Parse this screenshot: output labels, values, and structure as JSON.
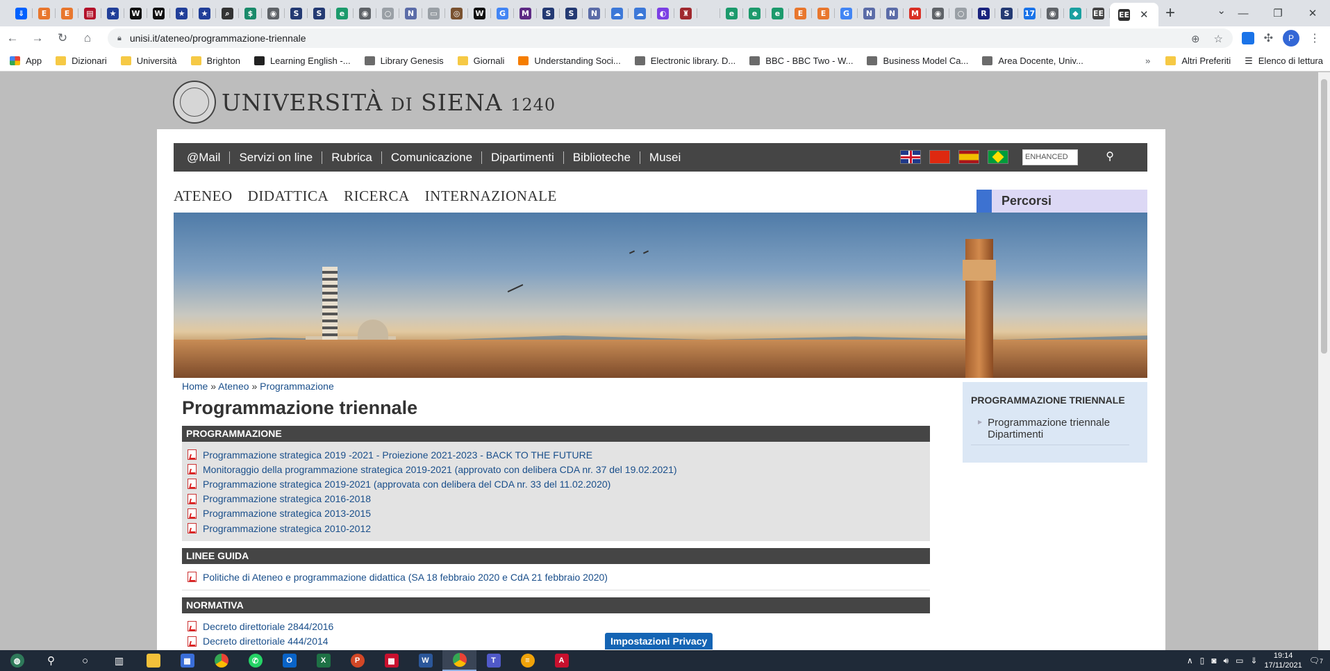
{
  "browser": {
    "tabs": [
      {
        "icon": "dropbox-icon",
        "glyph": "⇓",
        "color": "#0061fe"
      },
      {
        "icon": "e-icon",
        "glyph": "E",
        "color": "#e8772e"
      },
      {
        "icon": "e-icon",
        "glyph": "E",
        "color": "#e8772e"
      },
      {
        "icon": "book-icon",
        "glyph": "▤",
        "color": "#b3122a"
      },
      {
        "icon": "eu-icon",
        "glyph": "★",
        "color": "#213f99"
      },
      {
        "icon": "wikipedia-icon",
        "glyph": "W",
        "color": "#111111"
      },
      {
        "icon": "wikipedia-icon",
        "glyph": "W",
        "color": "#111111"
      },
      {
        "icon": "eu-icon",
        "glyph": "★",
        "color": "#213f99"
      },
      {
        "icon": "eu-icon",
        "glyph": "★",
        "color": "#213f99"
      },
      {
        "icon": "search-icon",
        "glyph": "⌕",
        "color": "#333333"
      },
      {
        "icon": "s-icon",
        "glyph": "$",
        "color": "#1a8a6a"
      },
      {
        "icon": "globe-icon",
        "glyph": "◉",
        "color": "#5f6368"
      },
      {
        "icon": "s-icon",
        "glyph": "S",
        "color": "#243a73"
      },
      {
        "icon": "s-icon",
        "glyph": "S",
        "color": "#243a73"
      },
      {
        "icon": "edge-icon",
        "glyph": "e",
        "color": "#1c9a6c"
      },
      {
        "icon": "globe-icon",
        "glyph": "◉",
        "color": "#5f6368"
      },
      {
        "icon": "loading-icon",
        "glyph": "○",
        "color": "#9aa0a6"
      },
      {
        "icon": "nef-icon",
        "glyph": "N",
        "color": "#5b6ca8"
      },
      {
        "icon": "doc-icon",
        "glyph": "▭",
        "color": "#9aa0a6"
      },
      {
        "icon": "seal-icon",
        "glyph": "◎",
        "color": "#7a5230"
      },
      {
        "icon": "wikipedia-icon",
        "glyph": "W",
        "color": "#111111"
      },
      {
        "icon": "translate-icon",
        "glyph": "G",
        "color": "#4285f4"
      },
      {
        "icon": "m-icon",
        "glyph": "M",
        "color": "#5e2a84"
      },
      {
        "icon": "s-icon",
        "glyph": "S",
        "color": "#243a73"
      },
      {
        "icon": "s-icon",
        "glyph": "S",
        "color": "#243a73"
      },
      {
        "icon": "nef-icon",
        "glyph": "N",
        "color": "#5b6ca8"
      },
      {
        "icon": "cloud-icon",
        "glyph": "☁",
        "color": "#3c78d8"
      },
      {
        "icon": "cloud-icon",
        "glyph": "☁",
        "color": "#3c78d8"
      },
      {
        "icon": "colorful-icon",
        "glyph": "◐",
        "color": "#7b3fe4"
      },
      {
        "icon": "crest-icon",
        "glyph": "♜",
        "color": "#a0282e"
      },
      {
        "icon": "blank-icon",
        "glyph": " ",
        "color": "#dee1e6"
      },
      {
        "icon": "edge-icon",
        "glyph": "e",
        "color": "#1c9a6c"
      },
      {
        "icon": "edge-icon",
        "glyph": "e",
        "color": "#1c9a6c"
      },
      {
        "icon": "edge-icon",
        "glyph": "e",
        "color": "#1c9a6c"
      },
      {
        "icon": "e-icon",
        "glyph": "E",
        "color": "#e8772e"
      },
      {
        "icon": "e-icon",
        "glyph": "E",
        "color": "#e8772e"
      },
      {
        "icon": "translate-icon",
        "glyph": "G",
        "color": "#4285f4"
      },
      {
        "icon": "nef-icon",
        "glyph": "N",
        "color": "#5b6ca8"
      },
      {
        "icon": "nef-icon",
        "glyph": "N",
        "color": "#5b6ca8"
      },
      {
        "icon": "gmail-icon",
        "glyph": "M",
        "color": "#d93025"
      },
      {
        "icon": "globe-icon",
        "glyph": "◉",
        "color": "#5f6368"
      },
      {
        "icon": "loading-icon",
        "glyph": "○",
        "color": "#9aa0a6"
      },
      {
        "icon": "r-icon",
        "glyph": "R",
        "color": "#1a237e"
      },
      {
        "icon": "s-icon",
        "glyph": "S",
        "color": "#243a73"
      },
      {
        "icon": "calendar-icon",
        "glyph": "17",
        "color": "#1a73e8"
      },
      {
        "icon": "globe-icon",
        "glyph": "◉",
        "color": "#5f6368"
      },
      {
        "icon": "drop-icon",
        "glyph": "◆",
        "color": "#1aa0a0"
      },
      {
        "icon": "ee-icon",
        "glyph": "EE",
        "color": "#444444"
      }
    ],
    "url": "unisi.it/ateneo/programmazione-triennale",
    "bookmarks": [
      {
        "label": "App",
        "type": "apps"
      },
      {
        "label": "Dizionari",
        "type": "folder"
      },
      {
        "label": "Università",
        "type": "folder"
      },
      {
        "label": "Brighton",
        "type": "folder"
      },
      {
        "label": "Learning English -...",
        "type": "bbc"
      },
      {
        "label": "Library Genesis",
        "type": "site"
      },
      {
        "label": "Giornali",
        "type": "folder"
      },
      {
        "label": "Understanding Soci...",
        "type": "blogger"
      },
      {
        "label": "Electronic library. D...",
        "type": "site"
      },
      {
        "label": "BBC - BBC Two - W...",
        "type": "site"
      },
      {
        "label": "Business Model Ca...",
        "type": "site"
      },
      {
        "label": "Area Docente, Univ...",
        "type": "site"
      }
    ],
    "bookmarks_right": {
      "other": "Altri Preferiti",
      "reading": "Elenco di lettura"
    },
    "profile_initial": "P"
  },
  "site": {
    "logo": {
      "main": "UNIVERSITÀ",
      "di": "DI",
      "siena": "SIENA",
      "year": "1240"
    },
    "topnav": [
      "@Mail",
      "Servizi on line",
      "Rubrica",
      "Comunicazione",
      "Dipartimenti",
      "Biblioteche",
      "Musei"
    ],
    "search_value": "ENHANCED",
    "mainnav": [
      "ATENEO",
      "DIDATTICA",
      "RICERCA",
      "INTERNAZIONALE"
    ],
    "percorsi": "Percorsi",
    "breadcrumb": {
      "home": "Home",
      "sep": "»",
      "ateneo": "Ateneo",
      "current": "Programmazione"
    },
    "title": "Programmazione triennale",
    "sections": [
      {
        "heading": "PROGRAMMAZIONE",
        "style": "grey",
        "items": [
          "Programmazione strategica 2019 -2021 - Proiezione 2021-2023 - BACK TO THE FUTURE",
          "Monitoraggio della programmazione strategica 2019-2021 (approvato con delibera CDA nr. 37 del 19.02.2021)",
          "Programmazione strategica 2019-2021 (approvata con delibera del CDA nr. 33 del 11.02.2020)",
          "Programmazione strategica 2016-2018",
          "Programmazione strategica 2013-2015",
          "Programmazione strategica 2010-2012"
        ]
      },
      {
        "heading": "LINEE GUIDA",
        "style": "white",
        "items": [
          "Politiche di Ateneo e programmazione didattica (SA 18 febbraio 2020 e CdA 21 febbraio 2020)"
        ]
      },
      {
        "heading": "NORMATIVA",
        "style": "white",
        "items": [
          "Decreto direttoriale 2844/2016",
          "Decreto direttoriale 444/2014"
        ]
      }
    ],
    "sidebar": {
      "title": "PROGRAMMAZIONE TRIENNALE",
      "link": "Programmazione triennale Dipartimenti"
    },
    "privacy": "Impostazioni Privacy"
  },
  "taskbar": {
    "time": "19:14",
    "date": "17/11/2021",
    "notification_count": "7"
  }
}
